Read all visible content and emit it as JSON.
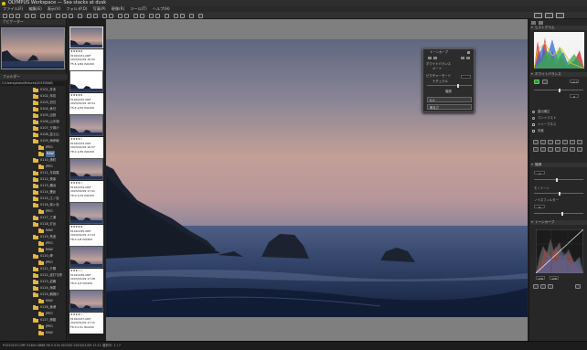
{
  "app": {
    "title": "OLYMPUS Workspace — Sea stacks at dusk"
  },
  "menu": [
    "ファイル(F)",
    "編集(E)",
    "表示(V)",
    "フォルダ(D)",
    "写真(P)",
    "現像(R)",
    "ツール(T)",
    "ヘルプ(H)"
  ],
  "left": {
    "navigator_title": "ナビゲーター",
    "folders_title": "フォルダー",
    "path": "C:\\Users\\photo\\Pictures\\2023\\RAW\\",
    "folders": [
      {
        "label": "0101_年末",
        "level": 0
      },
      {
        "label": "0102_年初",
        "level": 0
      },
      {
        "label": "0103_初日",
        "level": 0
      },
      {
        "label": "0104_休日",
        "level": 0
      },
      {
        "label": "0105_出勤",
        "level": 0
      },
      {
        "label": "0106_山中湖",
        "level": 0
      },
      {
        "label": "0107_夕焼け",
        "level": 0
      },
      {
        "label": "0108_富士山",
        "level": 0
      },
      {
        "label": "0109_海岸線",
        "level": 0
      },
      {
        "label": "JPEG",
        "level": 1
      },
      {
        "label": "RAW",
        "level": 1,
        "selected": true
      },
      {
        "label": "0110_港町",
        "level": 0
      },
      {
        "label": "JPEG",
        "level": 1
      },
      {
        "label": "0111_写真展",
        "level": 0
      },
      {
        "label": "0112_夜景",
        "level": 0
      },
      {
        "label": "0113_横浜",
        "level": 0
      },
      {
        "label": "0114_鎌倉",
        "level": 0
      },
      {
        "label": "0115_江ノ島",
        "level": 0
      },
      {
        "label": "0116_城ヶ島",
        "level": 0
      },
      {
        "label": "JPEG",
        "level": 1
      },
      {
        "label": "0117_三浦",
        "level": 0
      },
      {
        "label": "0118_灯台",
        "level": 0
      },
      {
        "label": "RAW",
        "level": 1
      },
      {
        "label": "0119_荒波",
        "level": 0
      },
      {
        "label": "JPEG",
        "level": 1
      },
      {
        "label": "RAW",
        "level": 1
      },
      {
        "label": "0120_岬",
        "level": 0
      },
      {
        "label": "JPEG",
        "level": 1
      },
      {
        "label": "0121_夕陽",
        "level": 0
      },
      {
        "label": "0122_波打ち際",
        "level": 0
      },
      {
        "label": "0123_岩礁",
        "level": 0
      },
      {
        "label": "0124_海霧",
        "level": 0
      },
      {
        "label": "0125_朝焼け",
        "level": 0
      },
      {
        "label": "RAW",
        "level": 1
      },
      {
        "label": "0126_漁港",
        "level": 0
      },
      {
        "label": "JPEG",
        "level": 1
      },
      {
        "label": "0127_帰路",
        "level": 0
      },
      {
        "label": "JPEG",
        "level": 1
      },
      {
        "label": "RAW",
        "level": 1
      }
    ]
  },
  "film": {
    "thumbs": [
      {
        "stars": "★★★★★",
        "l1": "P1010231.ORF",
        "l2": "2023/01/09 16:52",
        "l3": "F5.6 1/60 ISO200"
      },
      {
        "stars": "★★★★★",
        "l1": "P1010232.ORF",
        "l2": "2023/01/09 16:54",
        "l3": "F5.6 1/50 ISO200"
      },
      {
        "stars": "★★★★☆",
        "l1": "P1010233.ORF",
        "l2": "2023/01/09 16:57",
        "l3": "F8.0 1/30 ISO200"
      },
      {
        "stars": "★★★★☆",
        "l1": "P1010234.ORF",
        "l2": "2023/01/09 17:01",
        "l3": "F8.0 1/15 ISO200"
      },
      {
        "stars": "★★★★★",
        "l1": "P1010235.ORF",
        "l2": "2023/01/09 17:04",
        "l3": "F8.0 1/8 ISO200"
      },
      {
        "stars": "★★★☆☆",
        "l1": "P1010236.ORF",
        "l2": "2023/01/09 17:08",
        "l3": "F8.0 1/4 ISO200"
      },
      {
        "stars": "★★★★☆",
        "l1": "P1010237.ORF",
        "l2": "2023/01/09 17:11",
        "l3": "F8.0 0.5s ISO200"
      }
    ]
  },
  "float": {
    "title": "トーンカーブ",
    "label1": "ホワイトバランス",
    "value1": "オート",
    "label2": "ピクチャーモード",
    "value2": "ナチュラル",
    "label3": "階調",
    "input1": "0.0",
    "input2": "明るさ"
  },
  "right": {
    "tab_a": "調整",
    "tab_b": "情報",
    "histogram_title": "ヒストグラム",
    "labels": {
      "wb": "ホワイトバランス",
      "exposure": "露出補正",
      "contrast": "コントラスト",
      "sharp": "シャープネス",
      "saturation": "彩度",
      "gradation": "階調",
      "mono": "モノトーン",
      "noise": "ノイズフィルター",
      "curve": "トーンカーブ"
    },
    "values": {
      "exp": "+0.3",
      "tint": "0",
      "contrast": "-1",
      "sat": "0",
      "curve_in": "128",
      "curve_out": "128"
    }
  },
  "status": {
    "text": "P1010237.ORF  5184×3888  F8.0  0.5s  ISO200  2023/01/09 17:11  選択中: 1 / 7"
  }
}
